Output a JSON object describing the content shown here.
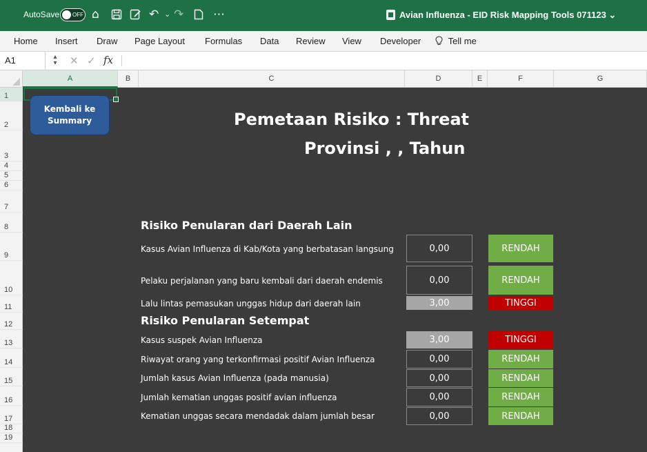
{
  "titlebar": {
    "autosave_label": "AutoSave",
    "autosave_state": "OFF",
    "document_title": "Avian Influenza - EID Risk Mapping Tools 071123",
    "title_chevron": "⌄",
    "icons": [
      "home-icon",
      "save-icon",
      "edit-icon",
      "undo-icon",
      "dropdown-icon",
      "redo-icon",
      "new-document-icon",
      "more-icon"
    ],
    "colors": {
      "background": "#1e7145"
    }
  },
  "ribbon": {
    "items": [
      "Home",
      "Insert",
      "Draw",
      "Page Layout",
      "Formulas",
      "Data",
      "Review",
      "View",
      "Developer",
      "Tell me"
    ]
  },
  "formula_bar": {
    "name_box": "A1",
    "fx_label": "fx",
    "formula_value": ""
  },
  "columns": [
    "A",
    "B",
    "C",
    "D",
    "E",
    "F",
    "G"
  ],
  "rows": [
    "1",
    "2",
    "3",
    "4",
    "5",
    "6",
    "7",
    "8",
    "9",
    "10",
    "11",
    "12",
    "13",
    "14",
    "15",
    "16",
    "17",
    "18",
    "19"
  ],
  "sheet": {
    "back_button": "Kembali ke\nSummary",
    "title_line1": "Pemetaan Risiko : Threat",
    "title_line2": "Provinsi , , Tahun",
    "colors": {
      "background": "#3b3b3b",
      "low": "#70ad47",
      "high": "#c00000",
      "value_highlight": "#a6a6a6",
      "button": "#2e5b9a"
    },
    "sections": [
      {
        "title": "Risiko Penularan dari Daerah Lain",
        "items": [
          {
            "label": "Kasus Avian Influenza di Kab/Kota yang berbatasan langsung",
            "value": "0,00",
            "risk": "RENDAH"
          },
          {
            "label": "Pelaku perjalanan yang baru kembali dari daerah endemis",
            "value": "0,00",
            "risk": "RENDAH"
          },
          {
            "label": "Lalu lintas pemasukan unggas hidup dari daerah lain",
            "value": "3,00",
            "risk": "TINGGI"
          }
        ]
      },
      {
        "title": "Risiko Penularan Setempat",
        "items": [
          {
            "label": "Kasus suspek Avian Influenza",
            "value": "3,00",
            "risk": "TINGGI"
          },
          {
            "label": "Riwayat orang yang terkonfirmasi positif Avian Influenza",
            "value": "0,00",
            "risk": "RENDAH"
          },
          {
            "label": "Jumlah kasus Avian Influenza (pada manusia)",
            "value": "0,00",
            "risk": "RENDAH"
          },
          {
            "label": "Jumlah kematian unggas positif avian influenza",
            "value": "0,00",
            "risk": "RENDAH"
          },
          {
            "label": "Kematian unggas secara mendadak dalam jumlah besar",
            "value": "0,00",
            "risk": "RENDAH"
          }
        ]
      }
    ]
  }
}
